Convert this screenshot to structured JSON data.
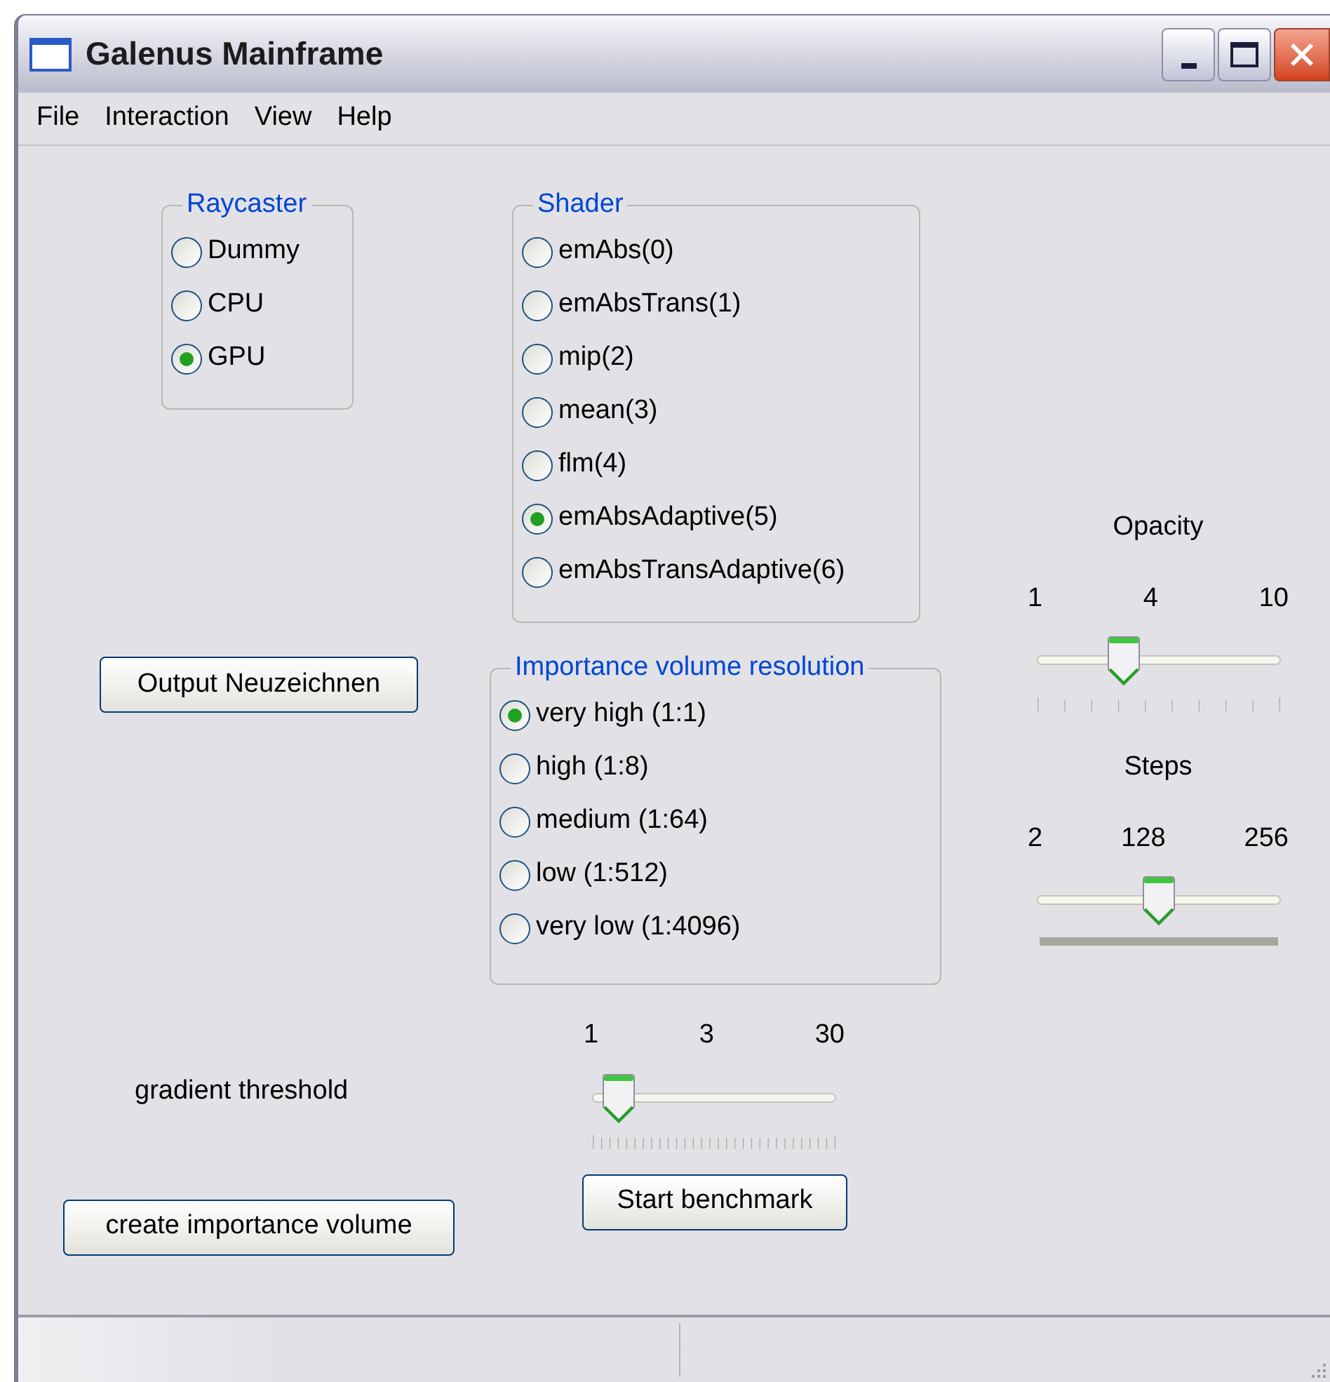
{
  "window": {
    "title": "Galenus Mainframe"
  },
  "menu": [
    "File",
    "Interaction",
    "View",
    "Help"
  ],
  "raycaster": {
    "title": "Raycaster",
    "options": [
      {
        "label": "Dummy",
        "selected": false
      },
      {
        "label": "CPU",
        "selected": false
      },
      {
        "label": "GPU",
        "selected": true
      }
    ]
  },
  "redraw_button": "Output Neuzeichnen",
  "gradient_label": "gradient threshold",
  "create_button": "create importance volume",
  "shader": {
    "title": "Shader",
    "options": [
      {
        "label": "emAbs(0)",
        "selected": false
      },
      {
        "label": "emAbsTrans(1)",
        "selected": false
      },
      {
        "label": "mip(2)",
        "selected": false
      },
      {
        "label": "mean(3)",
        "selected": false
      },
      {
        "label": "flm(4)",
        "selected": false
      },
      {
        "label": "emAbsAdaptive(5)",
        "selected": true
      },
      {
        "label": "emAbsTransAdaptive(6)",
        "selected": false
      }
    ]
  },
  "importance": {
    "title": "Importance volume resolution",
    "options": [
      {
        "label": "very high (1:1)",
        "selected": true
      },
      {
        "label": "high (1:8)",
        "selected": false
      },
      {
        "label": "medium (1:64)",
        "selected": false
      },
      {
        "label": "low (1:512)",
        "selected": false
      },
      {
        "label": "very low (1:4096)",
        "selected": false
      }
    ]
  },
  "gradient_slider": {
    "min": "1",
    "mid": "3",
    "max": "30",
    "level": 0.11,
    "kind": "dense"
  },
  "benchmark_button": "Start benchmark",
  "opacity": {
    "title": "Opacity",
    "min": "1",
    "mid": "4",
    "max": "10",
    "level": 0.36,
    "kind": "sparse"
  },
  "steps": {
    "title": "Steps",
    "min": "2",
    "mid": "128",
    "max": "256",
    "level": 0.5,
    "kind": "solid"
  }
}
